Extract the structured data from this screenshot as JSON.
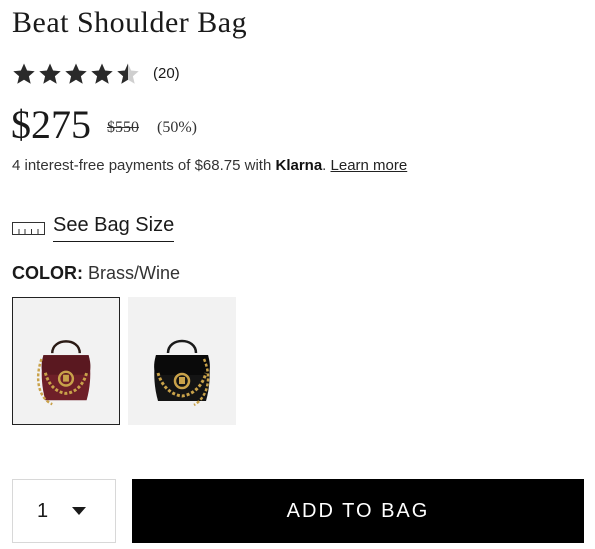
{
  "product": {
    "title": "Beat Shoulder Bag",
    "rating": 4.5,
    "rating_count": "(20)",
    "price": "$275",
    "original_price": "$550",
    "discount": "(50%)"
  },
  "klarna": {
    "text_prefix": "4 interest-free payments of $68.75 with ",
    "brand": "Klarna",
    "separator": ".",
    "learn_more": "Learn more"
  },
  "size_link": {
    "label": "See Bag Size",
    "icon": "ruler-icon"
  },
  "color": {
    "label": "COLOR:",
    "selected": "Brass/Wine",
    "swatches": [
      {
        "name": "Brass/Wine",
        "body_color": "#6e1f28",
        "selected": true
      },
      {
        "name": "Brass/Black",
        "body_color": "#141414",
        "selected": false
      }
    ]
  },
  "quantity": {
    "value": "1",
    "icon": "chevron-down-icon"
  },
  "add_to_bag": {
    "label": "ADD TO BAG"
  },
  "colors": {
    "text": "#1a1a1a",
    "button_bg": "#000000",
    "button_text": "#ffffff",
    "swatch_bg": "#f2f2f2",
    "hardware": "#c9a24a"
  }
}
